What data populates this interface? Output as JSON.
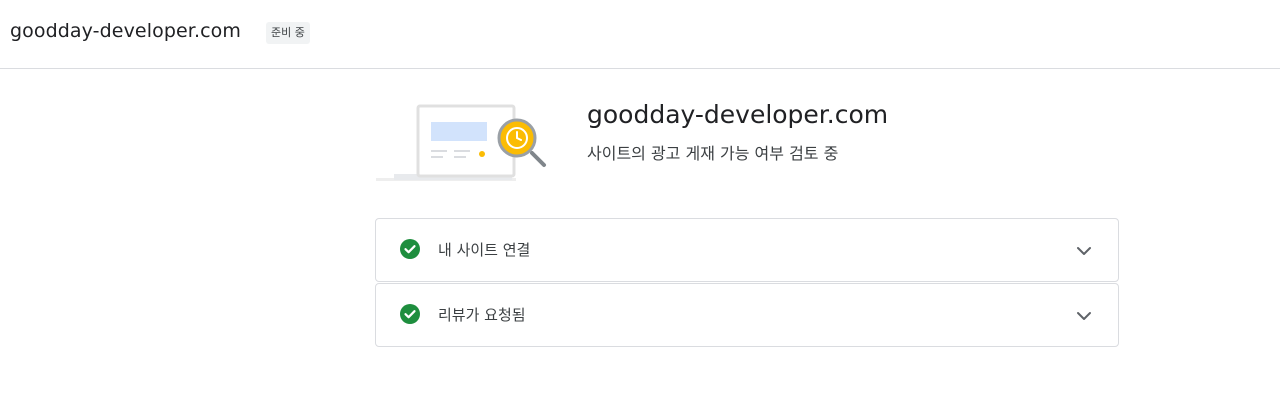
{
  "header": {
    "site_name": "goodday-developer.com",
    "status_badge": "준비 중"
  },
  "hero": {
    "title": "goodday-developer.com",
    "subtitle": "사이트의 광고 게재 가능 여부 검토 중",
    "illustration_icon": "site-review-illustration"
  },
  "steps": [
    {
      "label": "내 사이트 연결",
      "status": "complete",
      "icon": "check-circle-icon",
      "expand_icon": "chevron-down-icon"
    },
    {
      "label": "리뷰가 요청됨",
      "status": "complete",
      "icon": "check-circle-icon",
      "expand_icon": "chevron-down-icon"
    }
  ],
  "colors": {
    "success": "#1e8e3e",
    "accent_yellow": "#fbbc04",
    "divider": "#dadce0",
    "illustration_blue": "#d2e3fc"
  }
}
